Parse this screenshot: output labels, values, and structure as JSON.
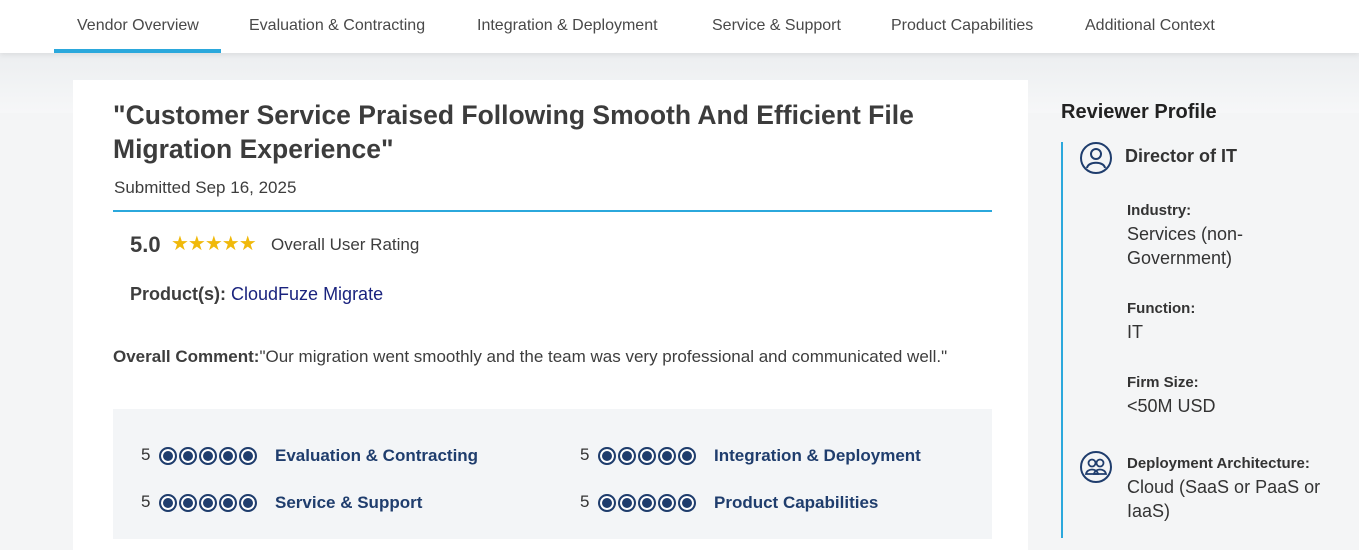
{
  "tabs": [
    {
      "label": "Vendor Overview",
      "active": true
    },
    {
      "label": "Evaluation & Contracting"
    },
    {
      "label": "Integration & Deployment"
    },
    {
      "label": "Service & Support"
    },
    {
      "label": "Product Capabilities"
    },
    {
      "label": "Additional Context"
    }
  ],
  "review": {
    "title": "\"Customer Service Praised Following Smooth And Efficient File Migration Experience\"",
    "submitted": "Submitted Sep 16, 2025",
    "rating_value": "5.0",
    "rating_stars": "★★★★★",
    "rating_label": "Overall User Rating",
    "products_label": "Product(s):",
    "product_name": "CloudFuze Migrate",
    "comment_label": "Overall Comment:",
    "comment_text": "\"Our migration went smoothly and the team was very professional and communicated well.\""
  },
  "sub_scores": [
    {
      "score": "5",
      "label": "Evaluation & Contracting"
    },
    {
      "score": "5",
      "label": "Integration & Deployment"
    },
    {
      "score": "5",
      "label": "Service & Support"
    },
    {
      "score": "5",
      "label": "Product Capabilities"
    }
  ],
  "reviewer": {
    "heading": "Reviewer Profile",
    "role": "Director of IT",
    "industry_label": "Industry:",
    "industry": "Services (non-Government)",
    "function_label": "Function:",
    "function": "IT",
    "firm_size_label": "Firm Size:",
    "firm_size": "<50M USD",
    "deployment_label": "Deployment Architecture:",
    "deployment": "Cloud (SaaS or PaaS or IaaS)"
  },
  "colors": {
    "accent": "#2ba8dc",
    "navy": "#1f3d6d",
    "star": "#f0b90b",
    "link": "#1a237e"
  },
  "icons": [
    "user-circle-icon",
    "group-cloud-icon",
    "star-icon",
    "score-dot-icon"
  ]
}
